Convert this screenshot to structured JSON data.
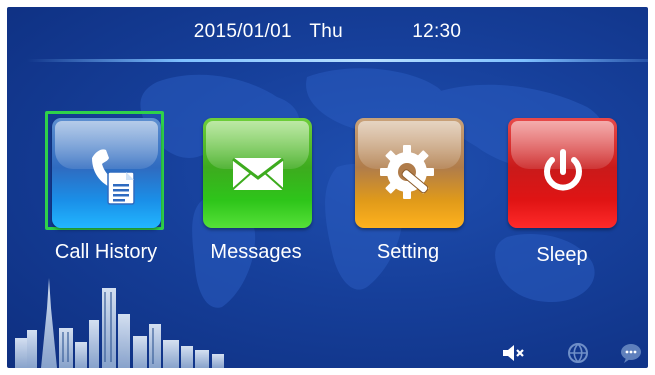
{
  "status_bar": {
    "date": "2015/01/01",
    "weekday": "Thu",
    "time": "12:30"
  },
  "menu": {
    "items": [
      {
        "label": "Call History",
        "icon": "call-history-icon",
        "selected": true
      },
      {
        "label": "Messages",
        "icon": "envelope-icon",
        "selected": false
      },
      {
        "label": "Setting",
        "icon": "gear-wrench-icon",
        "selected": false
      },
      {
        "label": "Sleep",
        "icon": "power-icon",
        "selected": false
      }
    ]
  },
  "tray": {
    "icons": [
      "speaker-mute-icon",
      "network-globe-icon",
      "chat-bubble-icon"
    ]
  },
  "colors": {
    "background": "#163f9a",
    "selection": "#2fd14a",
    "call_history": "#1a8fe8",
    "messages": "#3dab1e",
    "setting": "#e09a1a",
    "sleep": "#e01414"
  }
}
